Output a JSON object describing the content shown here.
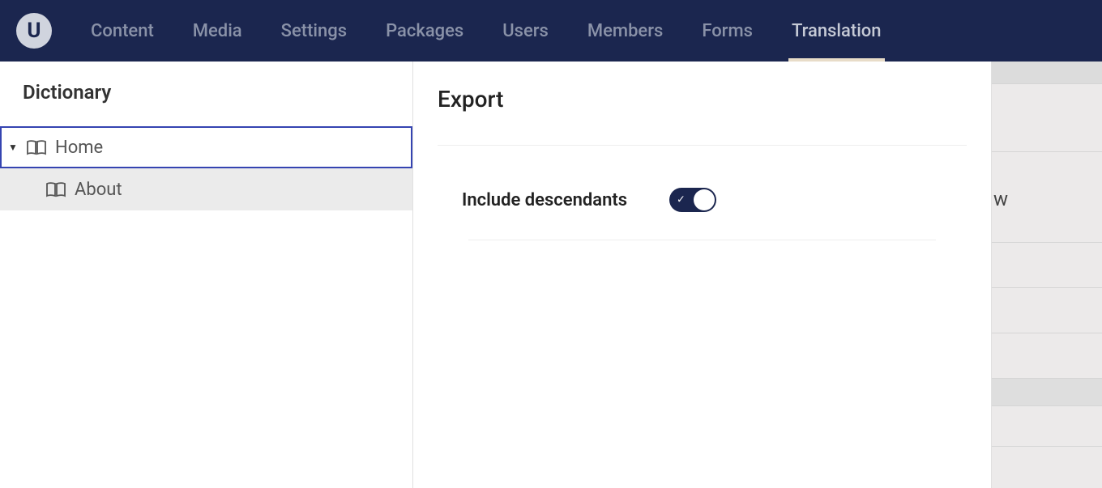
{
  "nav": {
    "items": [
      {
        "label": "Content"
      },
      {
        "label": "Media"
      },
      {
        "label": "Settings"
      },
      {
        "label": "Packages"
      },
      {
        "label": "Users"
      },
      {
        "label": "Members"
      },
      {
        "label": "Forms"
      },
      {
        "label": "Translation"
      }
    ],
    "active_index": 7
  },
  "sidebar": {
    "heading": "Dictionary",
    "tree": [
      {
        "label": "Home",
        "expanded": true,
        "selected": true
      },
      {
        "label": "About",
        "child": true
      }
    ]
  },
  "main": {
    "title": "Export",
    "fields": {
      "include_descendants_label": "Include descendants",
      "include_descendants_on": true
    }
  },
  "background": {
    "partial_text": "w"
  }
}
